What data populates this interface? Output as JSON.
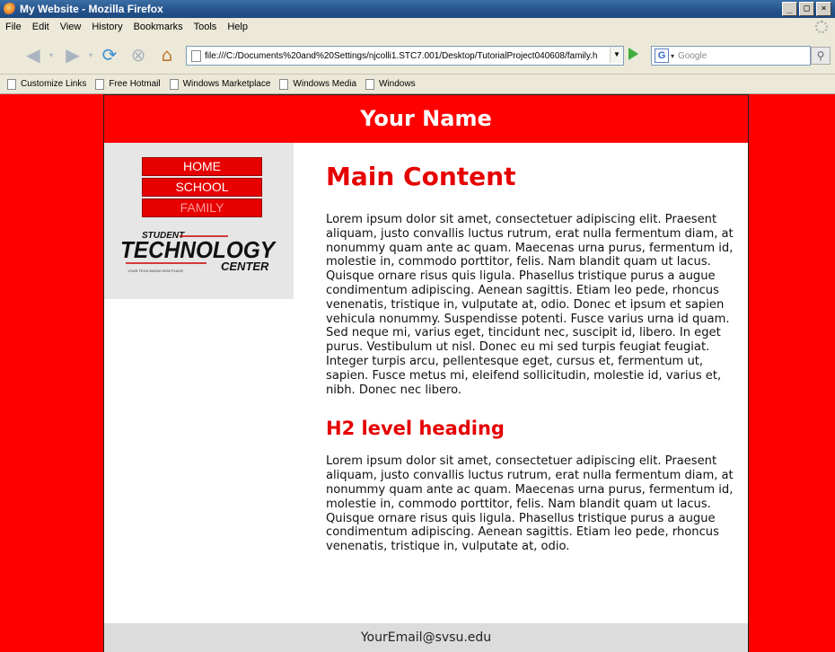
{
  "window": {
    "title": "My Website - Mozilla Firefox",
    "min": "_",
    "max": "□",
    "close": "×"
  },
  "menu": [
    "File",
    "Edit",
    "View",
    "History",
    "Bookmarks",
    "Tools",
    "Help"
  ],
  "toolbar": {
    "url": "file:///C:/Documents%20and%20Settings/njcolli1.STC7.001/Desktop/TutorialProject040608/family.h",
    "search_placeholder": "Google"
  },
  "bookmarks": [
    "Customize Links",
    "Free Hotmail",
    "Windows Marketplace",
    "Windows Media",
    "Windows"
  ],
  "page": {
    "header": "Your Name",
    "nav": [
      {
        "label": "HOME",
        "current": false
      },
      {
        "label": "SCHOOL",
        "current": false
      },
      {
        "label": "FAMILY",
        "current": true
      }
    ],
    "logo": {
      "line1": "STUDENT",
      "line2": "TECHNOLOGY",
      "line3": "CENTER",
      "tagline": "YOUR TECH KNOW HOW PLACE"
    },
    "h1": "Main Content",
    "p1": "Lorem ipsum dolor sit amet, consectetuer adipiscing elit. Praesent aliquam, justo convallis luctus rutrum, erat nulla fermentum diam, at nonummy quam ante ac quam. Maecenas urna purus, fermentum id, molestie in, commodo porttitor, felis. Nam blandit quam ut lacus. Quisque ornare risus quis ligula. Phasellus tristique purus a augue condimentum adipiscing. Aenean sagittis. Etiam leo pede, rhoncus venenatis, tristique in, vulputate at, odio. Donec et ipsum et sapien vehicula nonummy. Suspendisse potenti. Fusce varius urna id quam. Sed neque mi, varius eget, tincidunt nec, suscipit id, libero. In eget purus. Vestibulum ut nisl. Donec eu mi sed turpis feugiat feugiat. Integer turpis arcu, pellentesque eget, cursus et, fermentum ut, sapien. Fusce metus mi, eleifend sollicitudin, molestie id, varius et, nibh. Donec nec libero.",
    "h2": "H2 level heading",
    "p2": "Lorem ipsum dolor sit amet, consectetuer adipiscing elit. Praesent aliquam, justo convallis luctus rutrum, erat nulla fermentum diam, at nonummy quam ante ac quam. Maecenas urna purus, fermentum id, molestie in, commodo porttitor, felis. Nam blandit quam ut lacus. Quisque ornare risus quis ligula. Phasellus tristique purus a augue condimentum adipiscing. Aenean sagittis. Etiam leo pede, rhoncus venenatis, tristique in, vulputate at, odio.",
    "footer": "YourEmail@svsu.edu"
  },
  "colors": {
    "brand_red": "#ff0000",
    "nav_red": "#e60000",
    "sidebar_gray": "#e6e6e6"
  }
}
